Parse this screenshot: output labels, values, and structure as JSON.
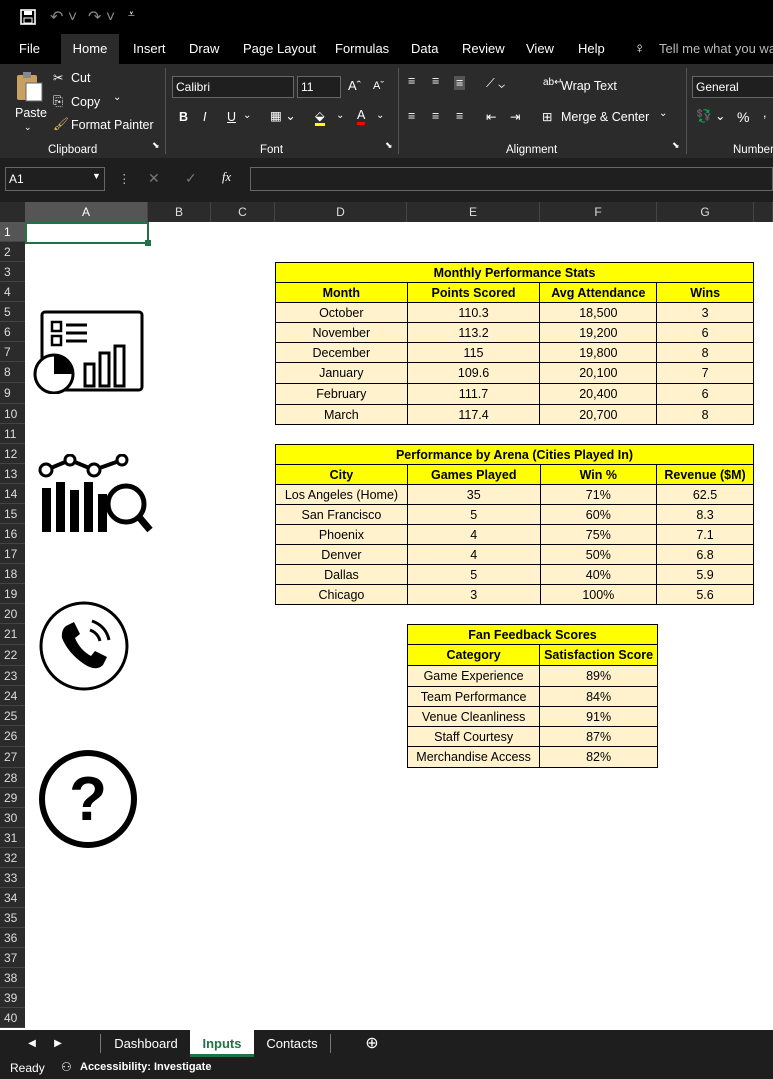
{
  "qat": {
    "save_icon": "save-icon",
    "undo_icon": "undo-icon",
    "redo_icon": "redo-icon"
  },
  "tabs": [
    "File",
    "Home",
    "Insert",
    "Draw",
    "Page Layout",
    "Formulas",
    "Data",
    "Review",
    "View",
    "Help"
  ],
  "tell_me": "Tell me what you want",
  "ribbon": {
    "paste": "Paste",
    "cut": "Cut",
    "copy": "Copy",
    "format_painter": "Format Painter",
    "clipboard": "Clipboard",
    "font_name": "Calibri",
    "font_size": "11",
    "font": "Font",
    "bold": "B",
    "italic": "I",
    "underline": "U",
    "wrap_text": "Wrap Text",
    "merge_center": "Merge & Center",
    "alignment": "Alignment",
    "number_format": "General",
    "number": "Number",
    "percent": "%"
  },
  "formula_bar": {
    "name_box": "A1",
    "fx": "fx",
    "value": ""
  },
  "columns": [
    "A",
    "B",
    "C",
    "D",
    "E",
    "F",
    "G"
  ],
  "rows": [
    "1",
    "2",
    "3",
    "4",
    "5",
    "6",
    "7",
    "8",
    "9",
    "10",
    "11",
    "12",
    "13",
    "14",
    "15",
    "16",
    "17",
    "18",
    "19",
    "20",
    "21",
    "22",
    "23",
    "24",
    "25",
    "26",
    "27",
    "28",
    "29",
    "30",
    "31",
    "32",
    "33",
    "34",
    "35",
    "36",
    "37",
    "38",
    "39",
    "40"
  ],
  "table1": {
    "title": "Monthly Performance Stats",
    "headers": [
      "Month",
      "Points Scored",
      "Avg Attendance",
      "Wins"
    ],
    "rows": [
      [
        "October",
        "110.3",
        "18,500",
        "3"
      ],
      [
        "November",
        "113.2",
        "19,200",
        "6"
      ],
      [
        "December",
        "115",
        "19,800",
        "8"
      ],
      [
        "January",
        "109.6",
        "20,100",
        "7"
      ],
      [
        "February",
        "111.7",
        "20,400",
        "6"
      ],
      [
        "March",
        "117.4",
        "20,700",
        "8"
      ]
    ]
  },
  "table2": {
    "title": "Performance by Arena (Cities Played In)",
    "headers": [
      "City",
      "Games Played",
      "Win %",
      "Revenue ($M)"
    ],
    "rows": [
      [
        "Los Angeles (Home)",
        "35",
        "71%",
        "62.5"
      ],
      [
        "San Francisco",
        "5",
        "60%",
        "8.3"
      ],
      [
        "Phoenix",
        "4",
        "75%",
        "7.1"
      ],
      [
        "Denver",
        "4",
        "50%",
        "6.8"
      ],
      [
        "Dallas",
        "5",
        "40%",
        "5.9"
      ],
      [
        "Chicago",
        "3",
        "100%",
        "5.6"
      ]
    ]
  },
  "table3": {
    "title": "Fan Feedback Scores",
    "headers": [
      "Category",
      "Satisfaction Score"
    ],
    "rows": [
      [
        "Game Experience",
        "89%"
      ],
      [
        "Team Performance",
        "84%"
      ],
      [
        "Venue Cleanliness",
        "91%"
      ],
      [
        "Staff Courtesy",
        "87%"
      ],
      [
        "Merchandise Access",
        "82%"
      ]
    ]
  },
  "sheets": [
    "Dashboard",
    "Inputs",
    "Contacts"
  ],
  "status": {
    "ready": "Ready",
    "accessibility": "Accessibility: Investigate"
  },
  "colors": {
    "accent": "#217346",
    "header_yellow": "#ffff00",
    "cell_fill": "#fff2cc"
  }
}
